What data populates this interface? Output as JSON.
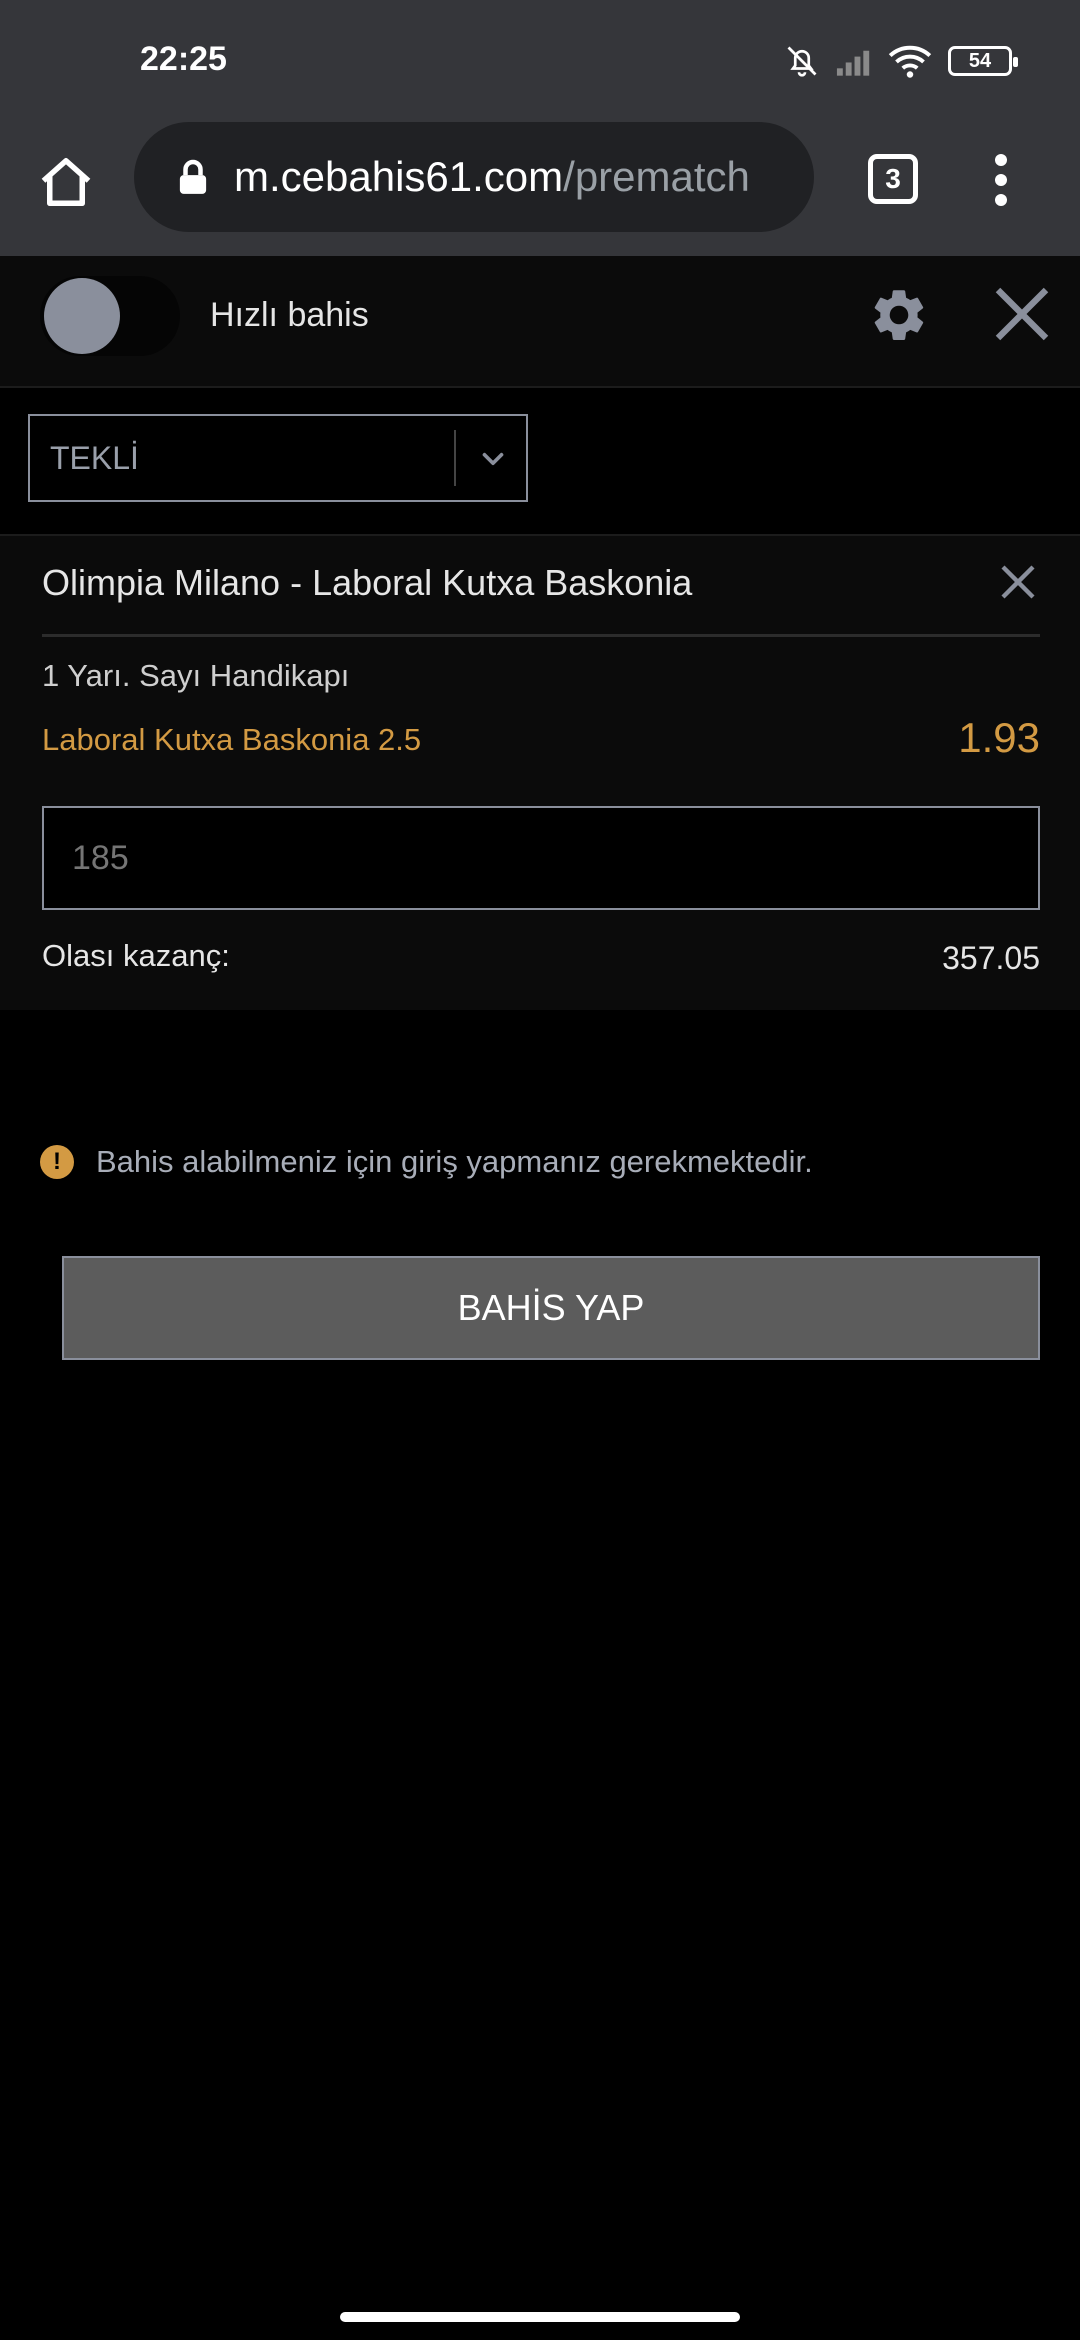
{
  "status_bar": {
    "time": "22:25",
    "battery": "54",
    "icons": [
      "bell-off-icon",
      "signal-icon",
      "wifi-icon",
      "battery-icon"
    ]
  },
  "browser": {
    "url_host": "m.cebahis61.com",
    "url_path": "/prematch",
    "tab_count": "3",
    "icons": [
      "home-icon",
      "lock-icon",
      "tabs-icon",
      "more-vert-icon"
    ]
  },
  "quick_bet": {
    "label": "Hızlı bahis",
    "toggle_on": false,
    "icons": [
      "gear-icon",
      "close-icon"
    ]
  },
  "bet_type": {
    "selected": "TEKLİ",
    "icon": "chevron-down-icon"
  },
  "bet_card": {
    "match": "Olimpia Milano - Laboral Kutxa Baskonia",
    "market": "1 Yarı. Sayı Handikapı",
    "selection": "Laboral Kutxa Baskonia 2.5",
    "odds": "1.93",
    "stake_placeholder": "185",
    "possible_win_label": "Olası kazanç:",
    "possible_win_value": "357.05"
  },
  "notice": {
    "text": "Bahis alabilmeniz için giriş yapmanız gerekmektedir.",
    "icon": "warning-icon"
  },
  "actions": {
    "place_bet": "BAHİS YAP"
  },
  "colors": {
    "accent": "#d39a43",
    "surface": "#0b0b0b",
    "browser_chrome": "#35363a",
    "button": "#5c5c5c"
  }
}
